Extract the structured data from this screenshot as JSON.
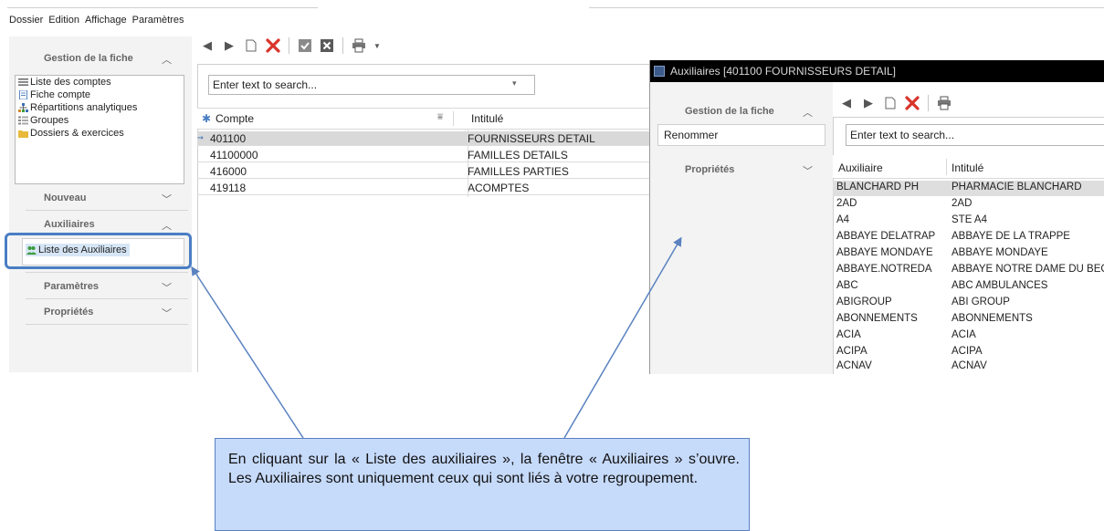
{
  "menubar": {
    "items": [
      "Dossier",
      "Edition",
      "Affichage",
      "Paramètres"
    ]
  },
  "left_nav": {
    "gestion_header": "Gestion de la fiche",
    "list_items": [
      "Liste des comptes",
      "Fiche compte",
      "Répartitions analytiques",
      "Groupes",
      "Dossiers & exercices"
    ],
    "nouveau_header": "Nouveau",
    "auxiliaires_header": "Auxiliaires",
    "aux_list_item": "Liste des Auxiliaires",
    "parametres_header": "Paramètres",
    "proprietes_header": "Propriétés"
  },
  "main": {
    "search_placeholder": "Enter text to search...",
    "columns": [
      "Compte",
      "Intitulé"
    ],
    "rows": [
      {
        "compte": "401100",
        "intitule": "FOURNISSEURS DETAIL",
        "selected": true
      },
      {
        "compte": "41100000",
        "intitule": "FAMILLES DETAILS"
      },
      {
        "compte": "416000",
        "intitule": "FAMILLES PARTIES"
      },
      {
        "compte": "419118",
        "intitule": "ACOMPTES"
      }
    ]
  },
  "aux_window": {
    "title": "Auxiliaires [401100 FOURNISSEURS DETAIL]",
    "gestion_header": "Gestion de la fiche",
    "rename_label": "Renommer",
    "proprietes_header": "Propriétés",
    "search_placeholder": "Enter text to search...",
    "columns": [
      "Auxiliaire",
      "Intitulé"
    ],
    "rows": [
      {
        "aux": "BLANCHARD PH",
        "intitule": "PHARMACIE BLANCHARD",
        "selected": true
      },
      {
        "aux": "2AD",
        "intitule": "2AD"
      },
      {
        "aux": "A4",
        "intitule": "STE A4"
      },
      {
        "aux": "ABBAYE DELATRAP",
        "intitule": "ABBAYE DE LA TRAPPE"
      },
      {
        "aux": "ABBAYE MONDAYE",
        "intitule": "ABBAYE MONDAYE"
      },
      {
        "aux": "ABBAYE.NOTREDA",
        "intitule": "ABBAYE NOTRE DAME DU BEC"
      },
      {
        "aux": "ABC",
        "intitule": "ABC AMBULANCES"
      },
      {
        "aux": "ABIGROUP",
        "intitule": "ABI GROUP"
      },
      {
        "aux": "ABONNEMENTS",
        "intitule": "ABONNEMENTS"
      },
      {
        "aux": "ACIA",
        "intitule": "ACIA"
      },
      {
        "aux": "ACIPA",
        "intitule": "ACIPA"
      },
      {
        "aux": "ACNAV",
        "intitule": "ACNAV"
      }
    ]
  },
  "callout": {
    "text": "En cliquant sur la « Liste des auxiliaires », la fenêtre « Auxiliaires » s’ouvre. Les Auxiliaires sont uniquement ceux qui sont liés à votre regroupement."
  },
  "colors": {
    "accent": "#4a7ec4",
    "delete_red": "#d9342b",
    "callout_bg": "#c6dafa",
    "selected_row": "#d9d9d9"
  }
}
